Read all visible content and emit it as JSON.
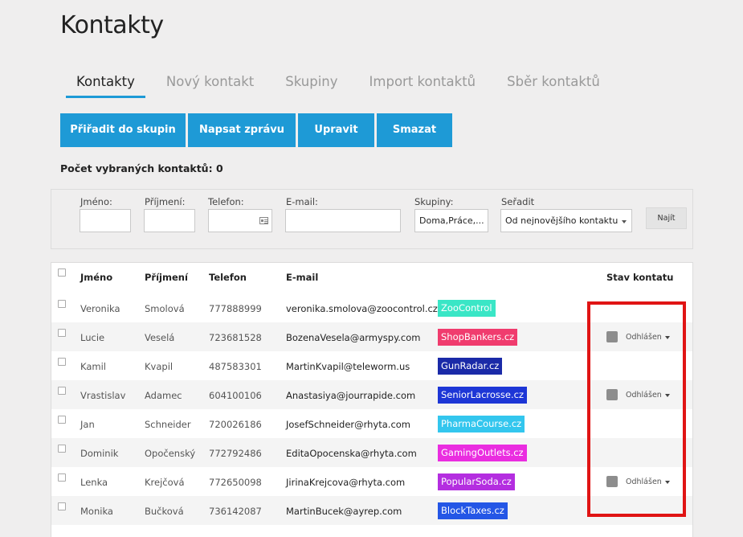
{
  "page_title": "Kontakty",
  "tabs": [
    {
      "label": "Kontakty",
      "active": true
    },
    {
      "label": "Nový kontakt",
      "active": false
    },
    {
      "label": "Skupiny",
      "active": false
    },
    {
      "label": "Import kontaktů",
      "active": false
    },
    {
      "label": "Sběr kontaktů",
      "active": false
    }
  ],
  "actions": {
    "assign_group": "Přiřadit do skupin",
    "write_message": "Napsat zprávu",
    "edit": "Upravit",
    "delete": "Smazat"
  },
  "selected_count": {
    "label": "Počet vybraných kontaktů:",
    "value": "0"
  },
  "filter": {
    "first_name_label": "Jméno:",
    "last_name_label": "Příjmení:",
    "phone_label": "Telefon:",
    "email_label": "E-mail:",
    "groups_label": "Skupiny:",
    "groups_value": "Doma,Práce,...",
    "sort_label": "Seřadit",
    "sort_value": "Od nejnovějšího kontaktu",
    "find_label": "Najít"
  },
  "table": {
    "headers": {
      "first_name": "Jméno",
      "last_name": "Příjmení",
      "phone": "Telefon",
      "email": "E-mail",
      "status": "Stav kontatu"
    },
    "rows": [
      {
        "first": "Veronika",
        "last": "Smolová",
        "phone": "777888999",
        "email": "veronika.smolova@zoocontrol.cz",
        "tag": "ZooControl",
        "tag_bg": "#3ae6c6",
        "tag_fg": "#ffffff",
        "status": ""
      },
      {
        "first": "Lucie",
        "last": "Veselá",
        "phone": "723681528",
        "email": "BozenaVesela@armyspy.com",
        "tag": "ShopBankers.cz",
        "tag_bg": "#f03c6e",
        "tag_fg": "#ffffff",
        "status": "Odhlášen"
      },
      {
        "first": "Kamil",
        "last": "Kvapil",
        "phone": "487583301",
        "email": "MartinKvapil@teleworm.us",
        "tag": "GunRadar.cz",
        "tag_bg": "#1a2aa8",
        "tag_fg": "#ffffff",
        "status": ""
      },
      {
        "first": "Vrastislav",
        "last": "Adamec",
        "phone": "604100106",
        "email": "Anastasiya@jourrapide.com",
        "tag": "SeniorLacrosse.cz",
        "tag_bg": "#1d36d6",
        "tag_fg": "#ffffff",
        "status": "Odhlášen"
      },
      {
        "first": "Jan",
        "last": "Schneider",
        "phone": "720026186",
        "email": "JosefSchneider@rhyta.com",
        "tag": "PharmaCourse.cz",
        "tag_bg": "#33c6ee",
        "tag_fg": "#ffffff",
        "status": ""
      },
      {
        "first": "Dominik",
        "last": "Opočenský",
        "phone": "772792486",
        "email": "EditaOpocenska@rhyta.com",
        "tag": "GamingOutlets.cz",
        "tag_bg": "#ea2de0",
        "tag_fg": "#ffffff",
        "status": ""
      },
      {
        "first": "Lenka",
        "last": "Krejčová",
        "phone": "772650098",
        "email": "JirinaKrejcova@rhyta.com",
        "tag": "PopularSoda.cz",
        "tag_bg": "#b42ee0",
        "tag_fg": "#ffffff",
        "status": "Odhlášen"
      },
      {
        "first": "Monika",
        "last": "Bučková",
        "phone": "736142087",
        "email": "MartinBucek@ayrep.com",
        "tag": "BlockTaxes.cz",
        "tag_bg": "#2456e6",
        "tag_fg": "#ffffff",
        "status": ""
      }
    ]
  },
  "colors": {
    "accent": "#1e9ad6",
    "highlight": "#e01414"
  }
}
